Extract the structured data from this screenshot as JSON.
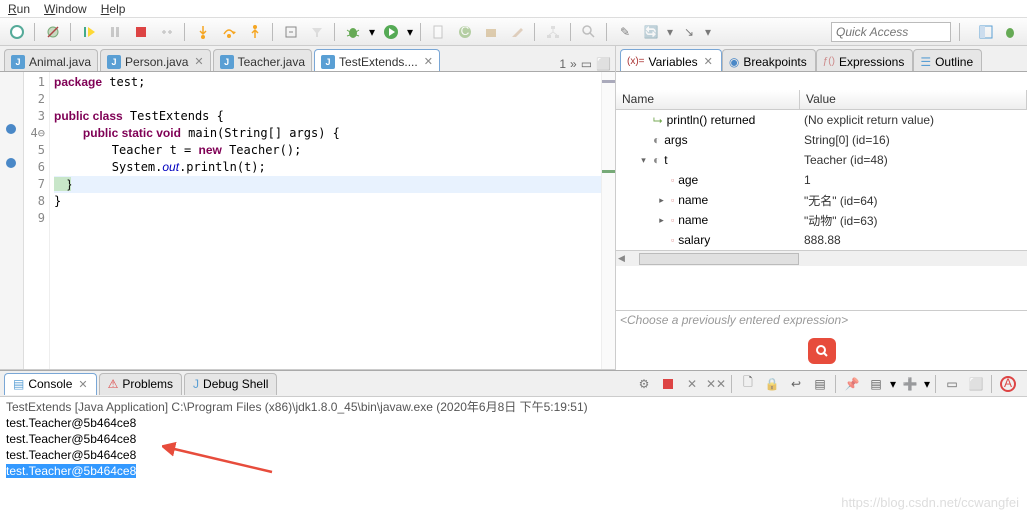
{
  "menu": {
    "items": [
      "Run",
      "Window",
      "Help"
    ]
  },
  "quick_access": {
    "placeholder": "Quick Access"
  },
  "editor_tabs": [
    {
      "icon": "J",
      "label": "Animal.java",
      "active": false
    },
    {
      "icon": "J",
      "label": "Person.java",
      "active": false,
      "close": true
    },
    {
      "icon": "J",
      "label": "Teacher.java",
      "active": false
    },
    {
      "icon": "J",
      "label": "TestExtends....",
      "active": true,
      "close": true
    }
  ],
  "editor_tab_extra": "1",
  "code": {
    "lines": [
      {
        "n": "1",
        "t": [
          [
            "kw",
            "package"
          ],
          [
            "",
            " test;"
          ]
        ]
      },
      {
        "n": "2",
        "t": [
          [
            "",
            ""
          ]
        ]
      },
      {
        "n": "3",
        "t": [
          [
            "kw",
            "public class"
          ],
          [
            "",
            " TestExtends {"
          ]
        ]
      },
      {
        "n": "4",
        "marker": "minus",
        "t": [
          [
            "",
            "    "
          ],
          [
            "kw",
            "public static void"
          ],
          [
            "",
            " main(String[] args) {"
          ]
        ]
      },
      {
        "n": "5",
        "t": [
          [
            "",
            "        Teacher t = "
          ],
          [
            "kw",
            "new"
          ],
          [
            "",
            " Teacher();"
          ]
        ]
      },
      {
        "n": "6",
        "t": [
          [
            "",
            "        System."
          ],
          [
            "fld",
            "out"
          ],
          [
            "",
            ".println(t);"
          ]
        ]
      },
      {
        "n": "7",
        "hl": "green",
        "cur": true,
        "t": [
          [
            "",
            "    }"
          ]
        ]
      },
      {
        "n": "8",
        "t": [
          [
            "",
            "}"
          ]
        ]
      },
      {
        "n": "9",
        "t": [
          [
            "",
            ""
          ]
        ]
      }
    ]
  },
  "view_tabs": [
    {
      "icon": "var",
      "label": "Variables",
      "active": true,
      "close": true
    },
    {
      "icon": "bp",
      "label": "Breakpoints"
    },
    {
      "icon": "expr",
      "label": "Expressions"
    },
    {
      "icon": "outline",
      "label": "Outline"
    }
  ],
  "var_header": {
    "name": "Name",
    "value": "Value"
  },
  "var_rows": [
    {
      "icon": "ret",
      "indent": 0,
      "expander": "",
      "name": "println() returned",
      "value": "(No explicit return value)"
    },
    {
      "icon": "local",
      "indent": 0,
      "expander": "",
      "name": "args",
      "value": "String[0]  (id=16)"
    },
    {
      "icon": "local",
      "indent": 0,
      "expander": "open",
      "name": "t",
      "value": "Teacher  (id=48)"
    },
    {
      "icon": "field",
      "indent": 1,
      "expander": "",
      "name": "age",
      "value": "1"
    },
    {
      "icon": "field",
      "indent": 1,
      "expander": "closed",
      "name": "name",
      "value": "\"无名\" (id=64)"
    },
    {
      "icon": "field",
      "indent": 1,
      "expander": "closed",
      "name": "name",
      "value": "\"动物\" (id=63)"
    },
    {
      "icon": "field",
      "indent": 1,
      "expander": "",
      "name": "salary",
      "value": "888.88"
    }
  ],
  "expr_placeholder": "<Choose a previously entered expression>",
  "console_tabs": [
    {
      "icon": "console",
      "label": "Console",
      "active": true,
      "close": true
    },
    {
      "icon": "problems",
      "label": "Problems"
    },
    {
      "icon": "debug",
      "label": "Debug Shell"
    }
  ],
  "console": {
    "title": "TestExtends [Java Application] C:\\Program Files (x86)\\jdk1.8.0_45\\bin\\javaw.exe (2020年6月8日 下午5:19:51)",
    "lines": [
      "test.Teacher@5b464ce8",
      "test.Teacher@5b464ce8",
      "test.Teacher@5b464ce8"
    ],
    "selected_line": "test.Teacher@5b464ce8"
  },
  "watermark": "https://blog.csdn.net/ccwangfei"
}
